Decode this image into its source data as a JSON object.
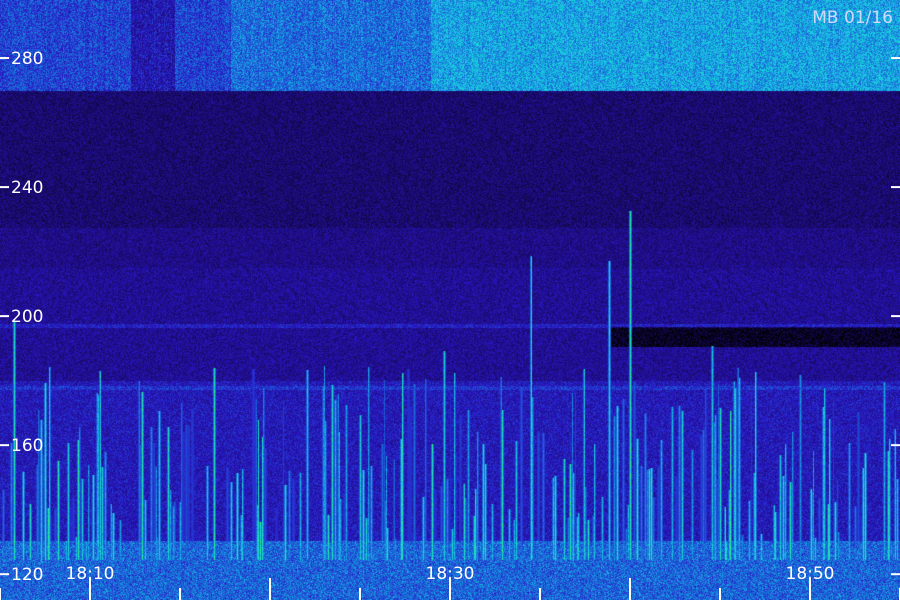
{
  "chart_data": {
    "type": "heatmap",
    "title": "",
    "stamp": "MB 01/16",
    "xlabel": "",
    "ylabel": "",
    "ylim": [
      112,
      298
    ],
    "y_ticks": [
      120,
      160,
      200,
      240,
      280
    ],
    "y_tick_labels": [
      "120",
      "160",
      "200",
      "240",
      "280"
    ],
    "x_range": [
      "18:05",
      "18:55"
    ],
    "x_ticks": [
      "18:10",
      "18:30",
      "18:50"
    ],
    "x_minor_tick_minutes": [
      5,
      10,
      15,
      20,
      25,
      30,
      35,
      40,
      45,
      50,
      55
    ],
    "colormap": [
      "#000000",
      "#1a0a6e",
      "#2a18c8",
      "#1a6ad8",
      "#18c8e8",
      "#20f0a0",
      "#30ff30"
    ],
    "noise_band_top": 282,
    "bright_band": [
      270,
      298
    ],
    "dark_band": [
      215,
      265
    ],
    "burst_band": [
      118,
      180
    ],
    "horizontal_lines": [
      197,
      178
    ]
  }
}
